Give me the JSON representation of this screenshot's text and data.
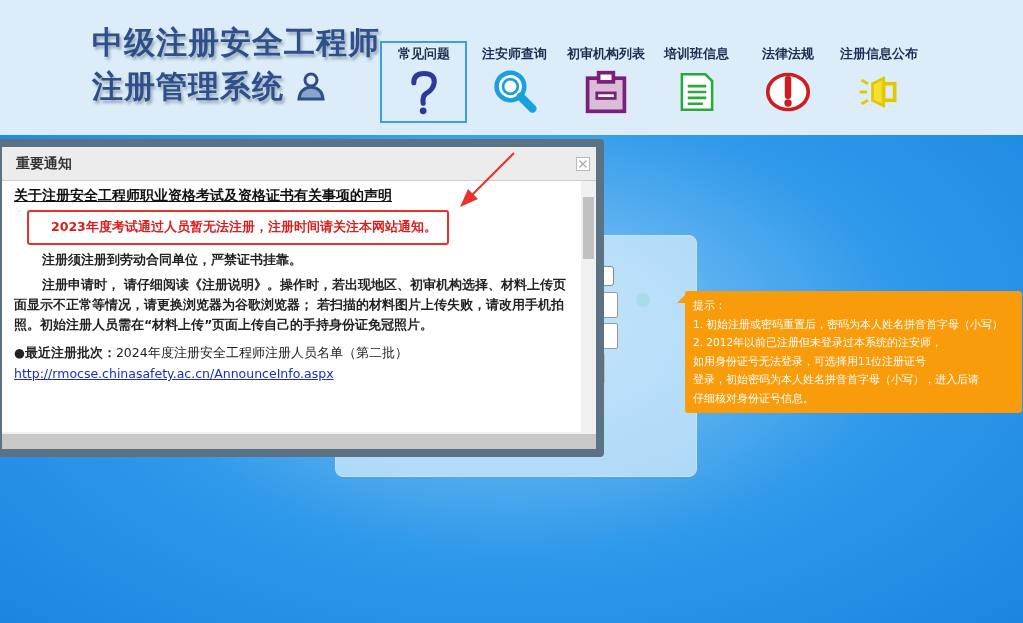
{
  "header": {
    "title_lines": [
      "中级注册安全工程师",
      "注册管理系统"
    ]
  },
  "nav": [
    {
      "label": "常见问题",
      "selected": true
    },
    {
      "label": "注安师查询",
      "selected": false
    },
    {
      "label": "初审机构列表",
      "selected": false
    },
    {
      "label": "培训班信息",
      "selected": false
    },
    {
      "label": "法律法规",
      "selected": false
    },
    {
      "label": "注册信息公布",
      "selected": false
    }
  ],
  "dialog": {
    "title": "重要通知",
    "heading": "关于注册安全工程师职业资格考试及资格证书有关事项的声明",
    "alert": "2023年度考试通过人员暂无法注册，注册时间请关注本网站通知。",
    "paragraphs": [
      "注册须注册到劳动合同单位，严禁证书挂靠。",
      "注册申请时， 请仔细阅读《注册说明》。操作时，若出现地区、初审机构选择、材料上传页面显示不正常等情况，请更换浏览器为谷歌浏览器； 若扫描的材料图片上传失败，请改用手机拍照。初始注册人员需在“材料上传”页面上传自己的手持身份证免冠照片。"
    ],
    "batch": "**●最近注册批次：**2024年度注册安全工程师注册人员名单（第二批）",
    "link": "http://rmocse.chinasafety.ac.cn/AnnounceInfo.aspx"
  },
  "tip": {
    "title": "提示：",
    "lines": [
      "1. 初始注册或密码重置后，密码为本人姓名拼音首字母（小写）",
      "2. 2012年以前已注册但未登录过本系统的注安师，",
      "如用身份证号无法登录，可选择用11位注册证号",
      "登录，初始密码为本人姓名拼音首字母（小写），进入后请",
      "仔细核对身份证号信息。"
    ]
  }
}
